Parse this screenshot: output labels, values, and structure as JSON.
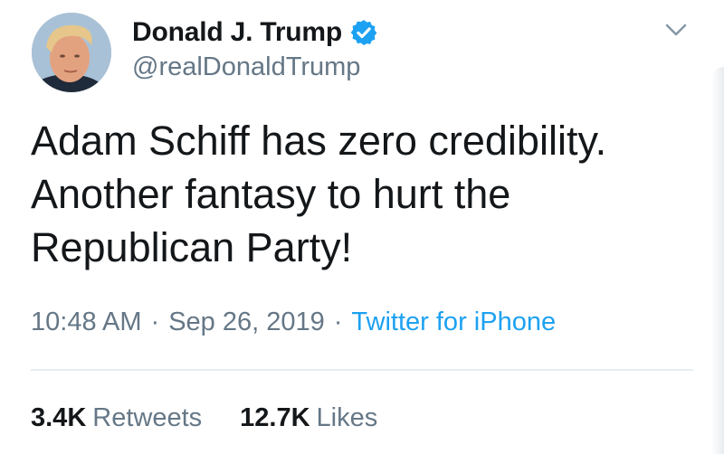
{
  "author": {
    "display_name": "Donald J. Trump",
    "handle": "@realDonaldTrump",
    "verified": true
  },
  "tweet": {
    "text_lines": [
      "Adam Schiff has zero credibility.",
      "Another fantasy to hurt the",
      "Republican Party!"
    ]
  },
  "meta": {
    "time": "10:48 AM",
    "separator": "·",
    "date": "Sep 26, 2019",
    "source": "Twitter for iPhone"
  },
  "stats": {
    "retweets_count": "3.4K",
    "retweets_label": "Retweets",
    "likes_count": "12.7K",
    "likes_label": "Likes"
  },
  "colors": {
    "text": "#14171a",
    "secondary": "#657786",
    "accent": "#1da1f2",
    "divider": "#e6ecf0"
  },
  "icons": {
    "verified": "verified-badge-icon",
    "menu": "chevron-down-icon"
  }
}
